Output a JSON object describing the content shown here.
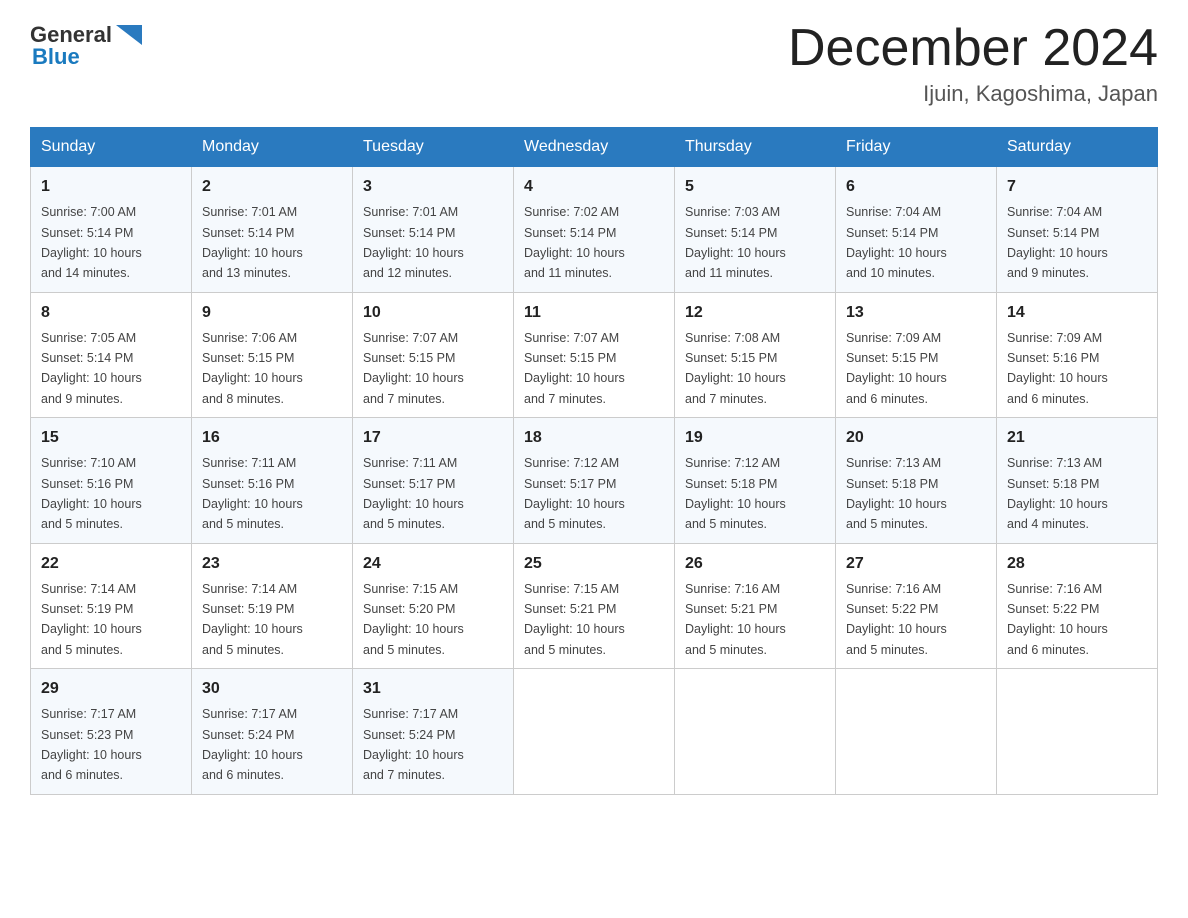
{
  "header": {
    "logo": {
      "general": "General",
      "triangle_color": "#2a7abf",
      "blue": "Blue"
    },
    "title": "December 2024",
    "location": "Ijuin, Kagoshima, Japan"
  },
  "weekdays": [
    "Sunday",
    "Monday",
    "Tuesday",
    "Wednesday",
    "Thursday",
    "Friday",
    "Saturday"
  ],
  "weeks": [
    [
      {
        "day": "1",
        "sunrise": "7:00 AM",
        "sunset": "5:14 PM",
        "daylight": "10 hours and 14 minutes."
      },
      {
        "day": "2",
        "sunrise": "7:01 AM",
        "sunset": "5:14 PM",
        "daylight": "10 hours and 13 minutes."
      },
      {
        "day": "3",
        "sunrise": "7:01 AM",
        "sunset": "5:14 PM",
        "daylight": "10 hours and 12 minutes."
      },
      {
        "day": "4",
        "sunrise": "7:02 AM",
        "sunset": "5:14 PM",
        "daylight": "10 hours and 11 minutes."
      },
      {
        "day": "5",
        "sunrise": "7:03 AM",
        "sunset": "5:14 PM",
        "daylight": "10 hours and 11 minutes."
      },
      {
        "day": "6",
        "sunrise": "7:04 AM",
        "sunset": "5:14 PM",
        "daylight": "10 hours and 10 minutes."
      },
      {
        "day": "7",
        "sunrise": "7:04 AM",
        "sunset": "5:14 PM",
        "daylight": "10 hours and 9 minutes."
      }
    ],
    [
      {
        "day": "8",
        "sunrise": "7:05 AM",
        "sunset": "5:14 PM",
        "daylight": "10 hours and 9 minutes."
      },
      {
        "day": "9",
        "sunrise": "7:06 AM",
        "sunset": "5:15 PM",
        "daylight": "10 hours and 8 minutes."
      },
      {
        "day": "10",
        "sunrise": "7:07 AM",
        "sunset": "5:15 PM",
        "daylight": "10 hours and 7 minutes."
      },
      {
        "day": "11",
        "sunrise": "7:07 AM",
        "sunset": "5:15 PM",
        "daylight": "10 hours and 7 minutes."
      },
      {
        "day": "12",
        "sunrise": "7:08 AM",
        "sunset": "5:15 PM",
        "daylight": "10 hours and 7 minutes."
      },
      {
        "day": "13",
        "sunrise": "7:09 AM",
        "sunset": "5:15 PM",
        "daylight": "10 hours and 6 minutes."
      },
      {
        "day": "14",
        "sunrise": "7:09 AM",
        "sunset": "5:16 PM",
        "daylight": "10 hours and 6 minutes."
      }
    ],
    [
      {
        "day": "15",
        "sunrise": "7:10 AM",
        "sunset": "5:16 PM",
        "daylight": "10 hours and 5 minutes."
      },
      {
        "day": "16",
        "sunrise": "7:11 AM",
        "sunset": "5:16 PM",
        "daylight": "10 hours and 5 minutes."
      },
      {
        "day": "17",
        "sunrise": "7:11 AM",
        "sunset": "5:17 PM",
        "daylight": "10 hours and 5 minutes."
      },
      {
        "day": "18",
        "sunrise": "7:12 AM",
        "sunset": "5:17 PM",
        "daylight": "10 hours and 5 minutes."
      },
      {
        "day": "19",
        "sunrise": "7:12 AM",
        "sunset": "5:18 PM",
        "daylight": "10 hours and 5 minutes."
      },
      {
        "day": "20",
        "sunrise": "7:13 AM",
        "sunset": "5:18 PM",
        "daylight": "10 hours and 5 minutes."
      },
      {
        "day": "21",
        "sunrise": "7:13 AM",
        "sunset": "5:18 PM",
        "daylight": "10 hours and 4 minutes."
      }
    ],
    [
      {
        "day": "22",
        "sunrise": "7:14 AM",
        "sunset": "5:19 PM",
        "daylight": "10 hours and 5 minutes."
      },
      {
        "day": "23",
        "sunrise": "7:14 AM",
        "sunset": "5:19 PM",
        "daylight": "10 hours and 5 minutes."
      },
      {
        "day": "24",
        "sunrise": "7:15 AM",
        "sunset": "5:20 PM",
        "daylight": "10 hours and 5 minutes."
      },
      {
        "day": "25",
        "sunrise": "7:15 AM",
        "sunset": "5:21 PM",
        "daylight": "10 hours and 5 minutes."
      },
      {
        "day": "26",
        "sunrise": "7:16 AM",
        "sunset": "5:21 PM",
        "daylight": "10 hours and 5 minutes."
      },
      {
        "day": "27",
        "sunrise": "7:16 AM",
        "sunset": "5:22 PM",
        "daylight": "10 hours and 5 minutes."
      },
      {
        "day": "28",
        "sunrise": "7:16 AM",
        "sunset": "5:22 PM",
        "daylight": "10 hours and 6 minutes."
      }
    ],
    [
      {
        "day": "29",
        "sunrise": "7:17 AM",
        "sunset": "5:23 PM",
        "daylight": "10 hours and 6 minutes."
      },
      {
        "day": "30",
        "sunrise": "7:17 AM",
        "sunset": "5:24 PM",
        "daylight": "10 hours and 6 minutes."
      },
      {
        "day": "31",
        "sunrise": "7:17 AM",
        "sunset": "5:24 PM",
        "daylight": "10 hours and 7 minutes."
      },
      null,
      null,
      null,
      null
    ]
  ],
  "labels": {
    "sunrise": "Sunrise:",
    "sunset": "Sunset:",
    "daylight": "Daylight:"
  }
}
